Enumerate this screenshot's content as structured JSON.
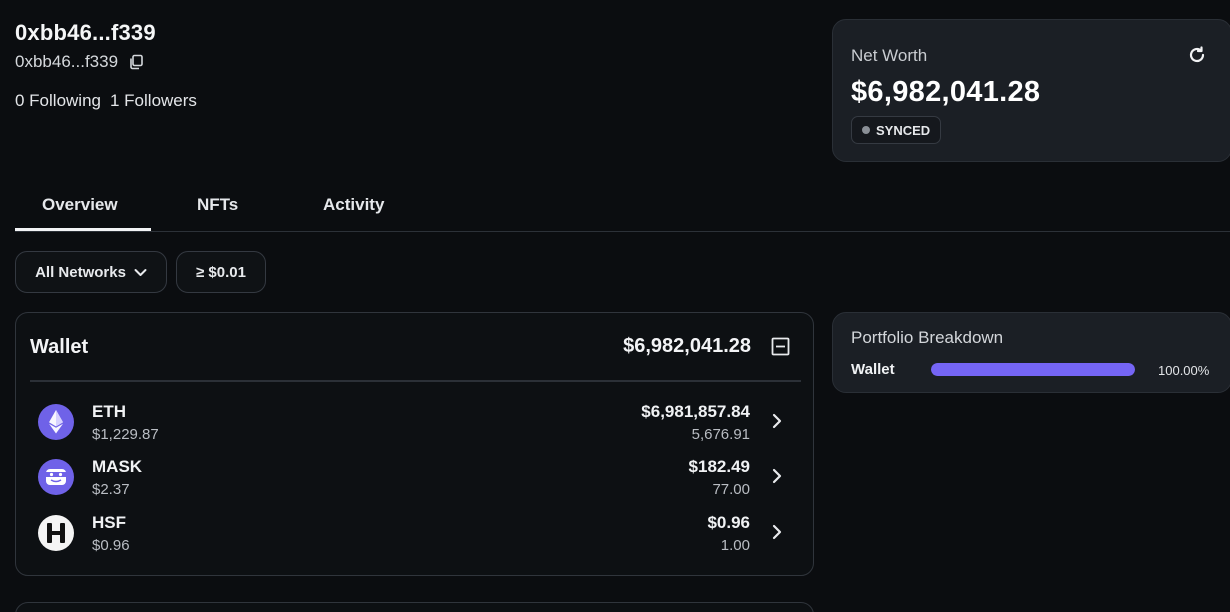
{
  "profile": {
    "title": "0xbb46...f339",
    "address_short": "0xbb46...f339",
    "following": "0 Following",
    "followers": "1 Followers"
  },
  "networth": {
    "label": "Net Worth",
    "value": "$6,982,041.28",
    "status": "SYNCED"
  },
  "tabs": [
    {
      "label": "Overview",
      "active": true
    },
    {
      "label": "NFTs",
      "active": false
    },
    {
      "label": "Activity",
      "active": false
    }
  ],
  "filters": {
    "network": "All Networks",
    "min_value": "≥ $0.01"
  },
  "wallet": {
    "title": "Wallet",
    "total": "$6,982,041.28",
    "tokens": [
      {
        "symbol": "ETH",
        "price": "$1,229.87",
        "value": "$6,981,857.84",
        "amount": "5,676.91",
        "icon": "eth-icon"
      },
      {
        "symbol": "MASK",
        "price": "$2.37",
        "value": "$182.49",
        "amount": "77.00",
        "icon": "mask-icon"
      },
      {
        "symbol": "HSF",
        "price": "$0.96",
        "value": "$0.96",
        "amount": "1.00",
        "icon": "hsf-icon"
      }
    ]
  },
  "breakdown": {
    "title": "Portfolio Breakdown",
    "label": "Wallet",
    "percent_text": "100.00%",
    "fraction": 1.0
  },
  "colors": {
    "accent": "#7565f5",
    "background": "#0b0d10",
    "card": "#1b1f25"
  }
}
